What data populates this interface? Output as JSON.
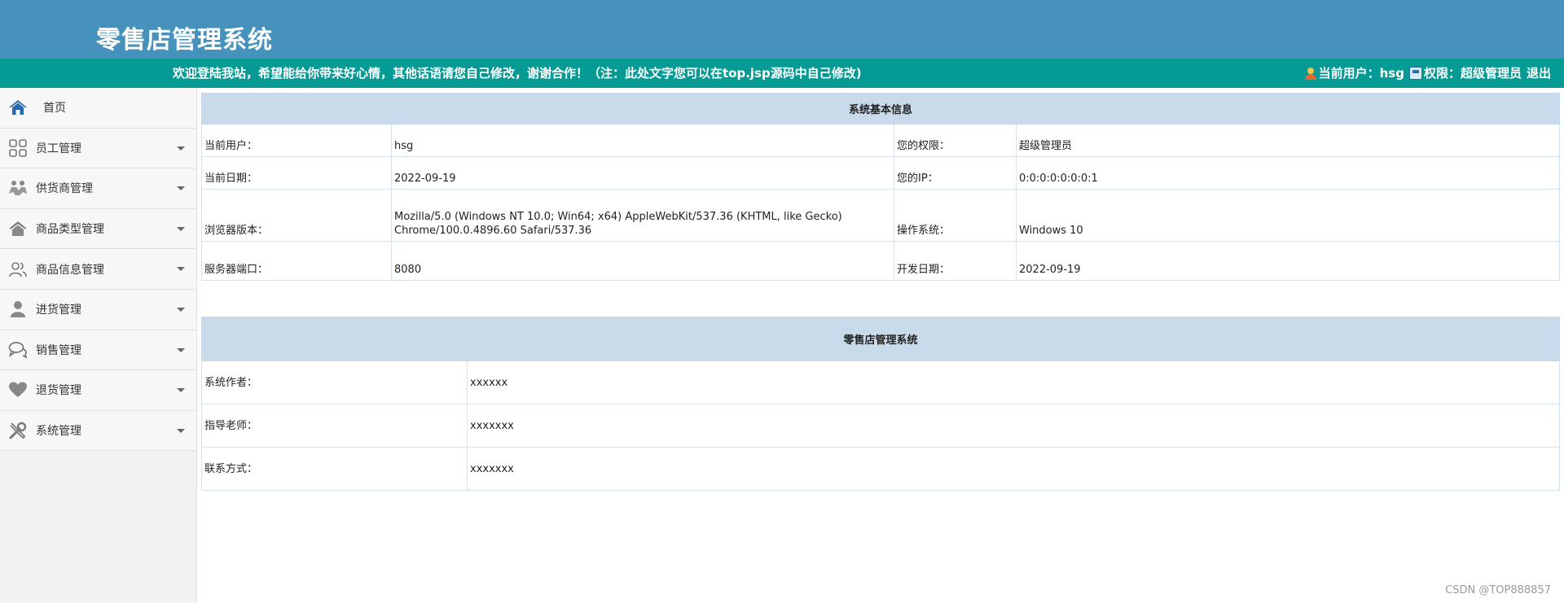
{
  "header": {
    "title": "零售店管理系统"
  },
  "topbar": {
    "welcome": "欢迎登陆我站，希望能给你带来好心情，其他话语请您自己修改，谢谢合作！（注：此处文字您可以在top.jsp源码中自己修改)",
    "current_user_label": "当前用户：",
    "current_user": "hsg",
    "permission_label": "权限：",
    "permission": "超级管理员",
    "logout": "退出"
  },
  "sidebar": {
    "items": [
      {
        "label": "首页",
        "icon": "home-icon"
      },
      {
        "label": "员工管理",
        "icon": "grid-icon"
      },
      {
        "label": "供货商管理",
        "icon": "handshake-icon"
      },
      {
        "label": "商品类型管理",
        "icon": "house-icon"
      },
      {
        "label": "商品信息管理",
        "icon": "users-icon"
      },
      {
        "label": "进货管理",
        "icon": "person-icon"
      },
      {
        "label": "销售管理",
        "icon": "chat-icon"
      },
      {
        "label": "退货管理",
        "icon": "heart-icon"
      },
      {
        "label": "系统管理",
        "icon": "tools-icon"
      }
    ]
  },
  "sysinfo": {
    "title": "系统基本信息",
    "rows": [
      {
        "l1": "当前用户：",
        "v1": "hsg",
        "l2": "您的权限：",
        "v2": "超级管理员"
      },
      {
        "l1": "当前日期：",
        "v1": "2022-09-19",
        "l2": "您的IP：",
        "v2": "0:0:0:0:0:0:0:1"
      },
      {
        "l1": "浏览器版本：",
        "v1": "Mozilla/5.0 (Windows NT 10.0; Win64; x64) AppleWebKit/537.36 (KHTML, like Gecko) Chrome/100.0.4896.60 Safari/537.36",
        "l2": "操作系统：",
        "v2": "Windows 10"
      },
      {
        "l1": "服务器端口：",
        "v1": "8080",
        "l2": "开发日期：",
        "v2": "2022-09-19"
      }
    ]
  },
  "about": {
    "title": "零售店管理系统",
    "rows": [
      {
        "label": "系统作者：",
        "value": "xxxxxx"
      },
      {
        "label": "指导老师：",
        "value": "xxxxxxx"
      },
      {
        "label": "联系方式：",
        "value": "xxxxxxx"
      }
    ]
  },
  "watermark": "CSDN @TOP888857",
  "colors": {
    "header_bg": "#4692bc",
    "topbar_bg": "#069a94",
    "table_head_bg": "#c9dbea",
    "sidebar_bg": "#f2f2f2"
  }
}
